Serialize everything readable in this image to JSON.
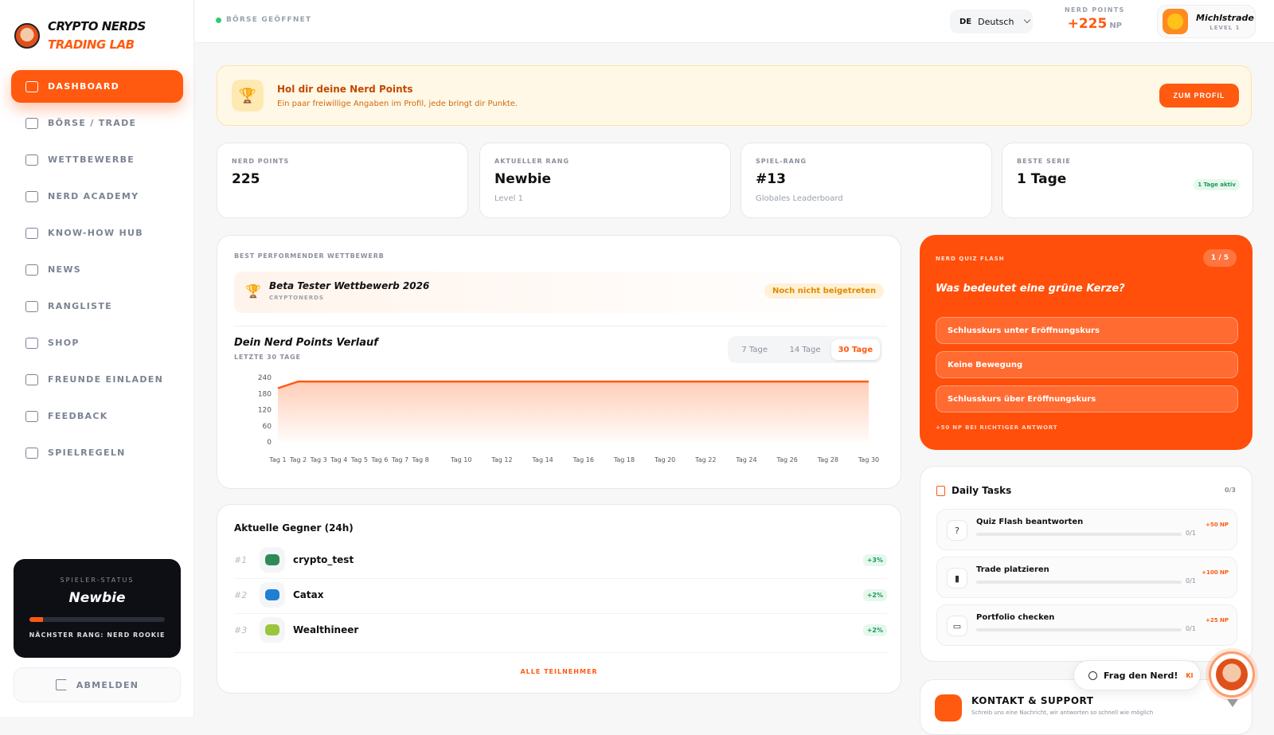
{
  "brand": {
    "line1": "CRYPTO NERDS",
    "line2": "TRADING LAB"
  },
  "nav": [
    {
      "label": "DASHBOARD",
      "icon": "home-icon",
      "active": true
    },
    {
      "label": "BÖRSE / TRADE",
      "icon": "chart-icon"
    },
    {
      "label": "WETTBEWERBE",
      "icon": "bag-icon"
    },
    {
      "label": "NERD ACADEMY",
      "icon": "graduation-icon"
    },
    {
      "label": "KNOW-HOW HUB",
      "icon": "bulb-icon"
    },
    {
      "label": "NEWS",
      "icon": "newspaper-icon"
    },
    {
      "label": "RANGLISTE",
      "icon": "bars-icon"
    },
    {
      "label": "SHOP",
      "icon": "lock-icon"
    },
    {
      "label": "FREUNDE EINLADEN",
      "icon": "user-plus-icon"
    },
    {
      "label": "FEEDBACK",
      "icon": "message-icon"
    },
    {
      "label": "SPIELREGELN",
      "icon": "book-icon"
    }
  ],
  "player_status": {
    "label": "SPIELER-STATUS",
    "rank": "Newbie",
    "progress": 0.1,
    "next": "NÄCHSTER RANG: NERD ROOKIE"
  },
  "logout": "ABMELDEN",
  "topbar": {
    "market": "BÖRSE GEÖFFNET",
    "lang_code": "DE",
    "lang": "Deutsch",
    "np_label": "NERD POINTS",
    "np_value": "+225",
    "np_unit": "NP",
    "user": "Michlstrade",
    "level": "LEVEL 1"
  },
  "banner": {
    "title": "Hol dir deine Nerd Points",
    "subtitle": "Ein paar freiwillige Angaben im Profil, jede bringt dir Punkte.",
    "button": "ZUM PROFIL"
  },
  "stats": [
    {
      "label": "NERD POINTS",
      "value": "225",
      "sub": ""
    },
    {
      "label": "AKTUELLER RANG",
      "value": "Newbie",
      "sub": "Level 1"
    },
    {
      "label": "SPIEL-RANG",
      "value": "#13",
      "sub": "Globales Leaderboard"
    },
    {
      "label": "BESTE SERIE",
      "value": "1 Tage",
      "sub": "",
      "badge": "1 Tage aktiv"
    }
  ],
  "best": {
    "label": "BEST PERFORMENDER WETTBEWERB",
    "name": "Beta Tester Wettbewerb 2026",
    "org": "CRYPTONERDS",
    "status": "Noch nicht beigetreten"
  },
  "history": {
    "title": "Dein Nerd Points Verlauf",
    "subtitle": "LETZTE 30 TAGE",
    "ranges": [
      "7 Tage",
      "14 Tage",
      "30 Tage"
    ],
    "active_range": "30 Tage"
  },
  "chart_data": {
    "type": "area",
    "x": [
      "Tag 1",
      "Tag 2",
      "Tag 3",
      "Tag 4",
      "Tag 5",
      "Tag 6",
      "Tag 7",
      "Tag 8",
      "Tag 9",
      "Tag 10",
      "Tag 11",
      "Tag 12",
      "Tag 13",
      "Tag 14",
      "Tag 15",
      "Tag 16",
      "Tag 17",
      "Tag 18",
      "Tag 19",
      "Tag 20",
      "Tag 21",
      "Tag 22",
      "Tag 23",
      "Tag 24",
      "Tag 25",
      "Tag 26",
      "Tag 27",
      "Tag 28",
      "Tag 29",
      "Tag 30"
    ],
    "tick_labels": [
      "Tag 1",
      "Tag 2",
      "Tag 3",
      "Tag 4",
      "Tag 5",
      "Tag 6",
      "Tag 7",
      "Tag 8",
      "Tag 10",
      "Tag 12",
      "Tag 14",
      "Tag 16",
      "Tag 18",
      "Tag 20",
      "Tag 22",
      "Tag 24",
      "Tag 26",
      "Tag 28",
      "Tag 30"
    ],
    "values": [
      200,
      225,
      225,
      225,
      225,
      225,
      225,
      225,
      225,
      225,
      225,
      225,
      225,
      225,
      225,
      225,
      225,
      225,
      225,
      225,
      225,
      225,
      225,
      225,
      225,
      225,
      225,
      225,
      225,
      225
    ],
    "yticks": [
      0,
      60,
      120,
      180,
      240
    ],
    "ylim": [
      0,
      240
    ],
    "color": "#ff5a10",
    "grid": false
  },
  "opponents": {
    "title": "Aktuelle Gegner (24h)",
    "rows": [
      {
        "rank": "#1",
        "name": "crypto_test",
        "change": "+3%",
        "color": "#2e8b57"
      },
      {
        "rank": "#2",
        "name": "Catax",
        "change": "+2%",
        "color": "#1f7fd1"
      },
      {
        "rank": "#3",
        "name": "Wealthineer",
        "change": "+2%",
        "color": "#9bc53d"
      }
    ],
    "all": "ALLE TEILNEHMER"
  },
  "quiz": {
    "label": "NERD QUIZ FLASH",
    "counter": "1 / 5",
    "question": "Was bedeutet eine grüne Kerze?",
    "answers": [
      "Schlusskurs unter Eröffnungskurs",
      "Keine Bewegung",
      "Schlusskurs über Eröffnungskurs"
    ],
    "hint": "+50 NP BEI RICHTIGER ANTWORT"
  },
  "tasks": {
    "title": "Daily Tasks",
    "count": "0/3",
    "items": [
      {
        "name": "Quiz Flash beantworten",
        "progress": "0/1",
        "points": "+50 NP",
        "icon": "question-icon"
      },
      {
        "name": "Trade platzieren",
        "progress": "0/1",
        "points": "+100 NP",
        "icon": "bars-icon"
      },
      {
        "name": "Portfolio checken",
        "progress": "0/1",
        "points": "+25 NP",
        "icon": "folder-icon"
      }
    ]
  },
  "support": {
    "title": "KONTAKT & SUPPORT",
    "subtitle": "Schreib uns eine Nachricht, wir antworten so schnell wie möglich"
  },
  "ask": {
    "label": "Frag den Nerd!",
    "badge": "KI"
  }
}
